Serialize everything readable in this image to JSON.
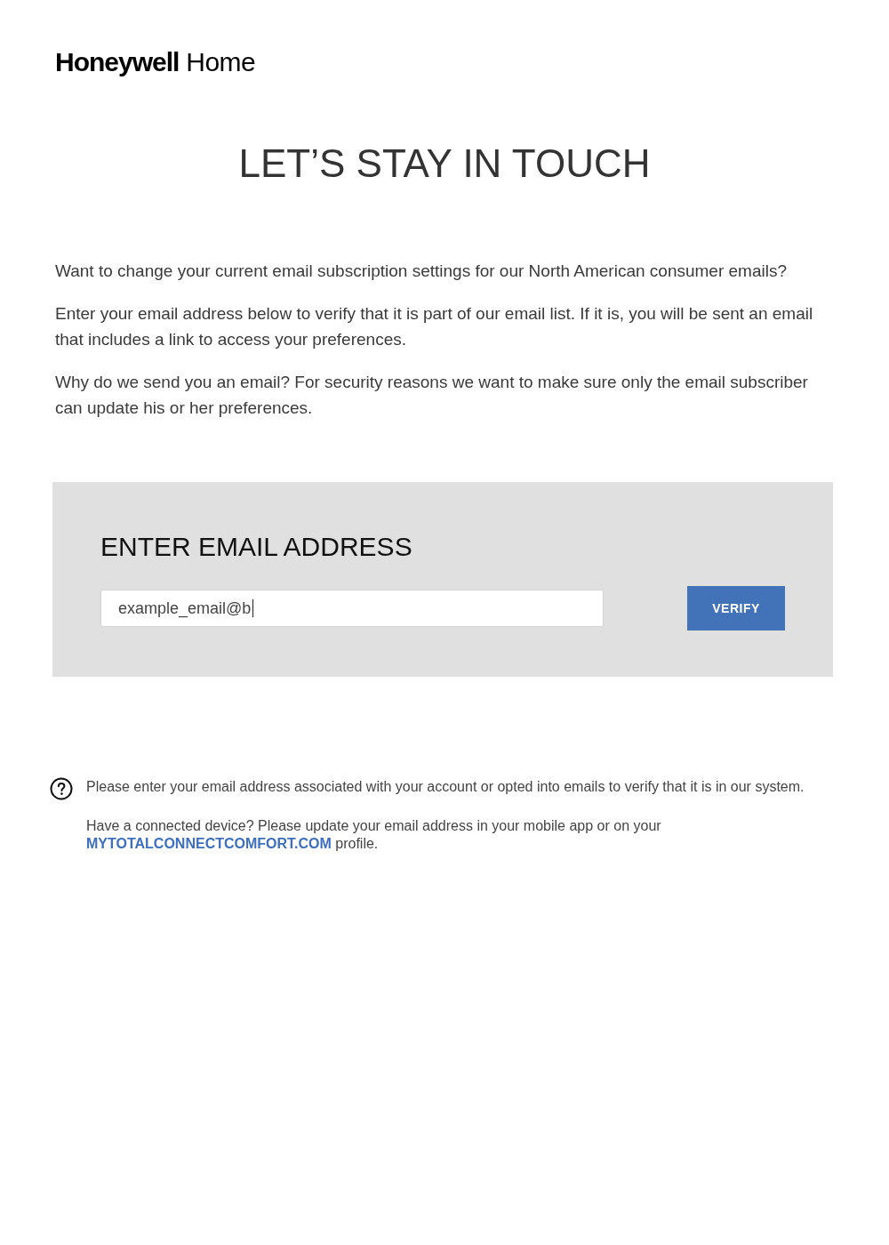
{
  "logo": "**Honeywell** Home",
  "title": "LET’S STAY IN TOUCH",
  "intro": [
    "Want to change your current email subscription settings for our North American consumer emails?",
    "Enter your email address below to verify that it is part of our email list. If it is, you will be sent an email that includes a link to access your preferences.",
    "Why do we send you an email? For security reasons we want to make sure only the email subscriber can update his or her preferences."
  ],
  "form": {
    "heading": "ENTER EMAIL ADDRESS",
    "email_field": {
      "value": "example_email@b",
      "focused": true
    },
    "verify_button": "VERIFY"
  },
  "help": {
    "note": "Please enter your email address associated with your account or opted into emails to verify that it is in our system.",
    "connected_device": {
      "text": "Have a connected device? Please update your email address in your mobile app or on your",
      "link": "MYTOTALCONNECTCOMFORT.COM",
      "text_after": "profile."
    }
  }
}
